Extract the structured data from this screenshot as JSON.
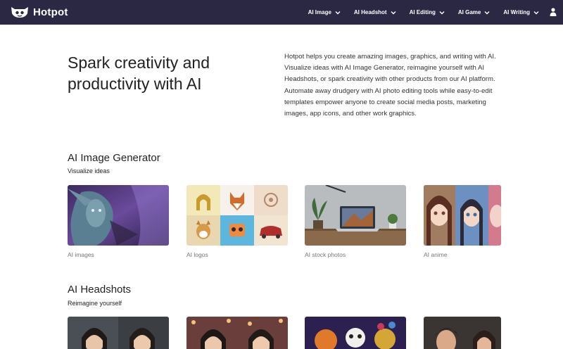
{
  "nav": {
    "brand": "Hotpot",
    "items": [
      {
        "label": "AI Image"
      },
      {
        "label": "AI Headshot"
      },
      {
        "label": "AI Editing"
      },
      {
        "label": "AI Game"
      },
      {
        "label": "AI Writing"
      }
    ]
  },
  "hero": {
    "title": "Spark creativity and productivity with AI",
    "description": "Hotpot helps you create amazing images, graphics, and writing with AI. Visualize ideas with AI Image Generator, reimagine yourself with AI Headshots, or spark creativity with other products from our AI platform. Automate away drudgery with AI photo editing tools while easy-to-edit templates empower anyone to create social media posts, marketing images, app icons, and other work graphics."
  },
  "sections": [
    {
      "title": "AI Image Generator",
      "subtitle": "Visualize ideas",
      "cards": [
        {
          "label": "AI images"
        },
        {
          "label": "AI logos"
        },
        {
          "label": "AI stock photos"
        },
        {
          "label": "AI anime"
        }
      ]
    },
    {
      "title": "AI Headshots",
      "subtitle": "Reimagine yourself"
    }
  ],
  "colors": {
    "navbar": "#2a2843",
    "text": "#222222",
    "muted": "#777777"
  }
}
